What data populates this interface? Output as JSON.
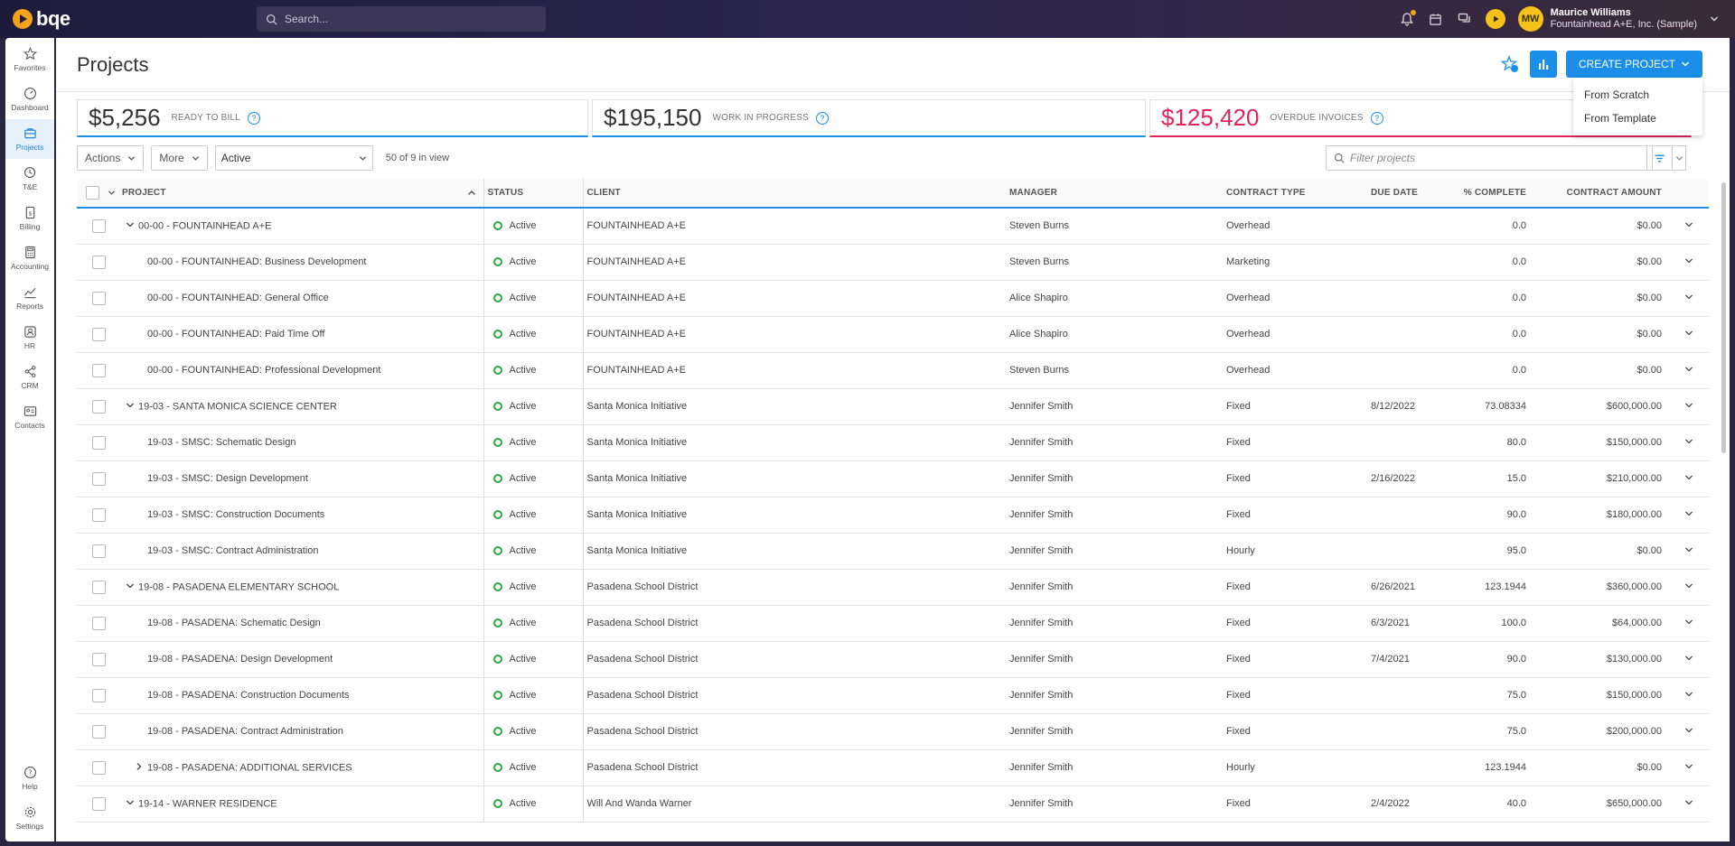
{
  "app": {
    "logo_text": "bqe",
    "search_placeholder": "Search..."
  },
  "user": {
    "initials": "MW",
    "name": "Maurice Williams",
    "org": "Fountainhead A+E, Inc. (Sample)"
  },
  "sidebar": {
    "items": [
      {
        "label": "Favorites",
        "icon": "star-icon"
      },
      {
        "label": "Dashboard",
        "icon": "dashboard-icon"
      },
      {
        "label": "Projects",
        "icon": "projects-icon",
        "active": true
      },
      {
        "label": "T&E",
        "icon": "clock-icon"
      },
      {
        "label": "Billing",
        "icon": "billing-icon"
      },
      {
        "label": "Accounting",
        "icon": "calculator-icon"
      },
      {
        "label": "Reports",
        "icon": "reports-icon"
      },
      {
        "label": "HR",
        "icon": "hr-icon"
      },
      {
        "label": "CRM",
        "icon": "crm-icon"
      },
      {
        "label": "Contacts",
        "icon": "contacts-icon"
      }
    ],
    "bottom": [
      {
        "label": "Help",
        "icon": "help-icon"
      },
      {
        "label": "Settings",
        "icon": "gear-icon"
      }
    ]
  },
  "page": {
    "title": "Projects",
    "create_label": "CREATE PROJECT",
    "create_menu": [
      "From Scratch",
      "From Template"
    ]
  },
  "kpis": [
    {
      "value": "$5,256",
      "label": "READY TO BILL",
      "color": "#333333",
      "accent": "#1a8ee8"
    },
    {
      "value": "$195,150",
      "label": "WORK IN PROGRESS",
      "color": "#333333",
      "accent": "#1a8ee8"
    },
    {
      "value": "$125,420",
      "label": "OVERDUE INVOICES",
      "color": "#e0245e",
      "accent": "#e0245e"
    }
  ],
  "toolbar": {
    "actions_label": "Actions",
    "more_label": "More",
    "status_filter": "Active",
    "in_view": "50 of 9 in view",
    "filter_placeholder": "Filter projects"
  },
  "table": {
    "headers": [
      "PROJECT",
      "STATUS",
      "CLIENT",
      "MANAGER",
      "CONTRACT TYPE",
      "DUE DATE",
      "% COMPLETE",
      "CONTRACT AMOUNT"
    ],
    "rows": [
      {
        "level": 0,
        "expander": "down",
        "project": "00-00 - FOUNTAINHEAD A+E",
        "status": "Active",
        "client": "FOUNTAINHEAD A+E",
        "manager": "Steven Burns",
        "type": "Overhead",
        "due": "",
        "pct": "0.0",
        "amount": "$0.00"
      },
      {
        "level": 1,
        "expander": "",
        "project": "00-00 - FOUNTAINHEAD: Business Development",
        "status": "Active",
        "client": "FOUNTAINHEAD A+E",
        "manager": "Steven Burns",
        "type": "Marketing",
        "due": "",
        "pct": "0.0",
        "amount": "$0.00"
      },
      {
        "level": 1,
        "expander": "",
        "project": "00-00 - FOUNTAINHEAD: General Office",
        "status": "Active",
        "client": "FOUNTAINHEAD A+E",
        "manager": "Alice Shapiro",
        "type": "Overhead",
        "due": "",
        "pct": "0.0",
        "amount": "$0.00"
      },
      {
        "level": 1,
        "expander": "",
        "project": "00-00 - FOUNTAINHEAD: Paid Time Off",
        "status": "Active",
        "client": "FOUNTAINHEAD A+E",
        "manager": "Alice Shapiro",
        "type": "Overhead",
        "due": "",
        "pct": "0.0",
        "amount": "$0.00"
      },
      {
        "level": 1,
        "expander": "",
        "project": "00-00 - FOUNTAINHEAD: Professional Development",
        "status": "Active",
        "client": "FOUNTAINHEAD A+E",
        "manager": "Steven Burns",
        "type": "Overhead",
        "due": "",
        "pct": "0.0",
        "amount": "$0.00"
      },
      {
        "level": 0,
        "expander": "down",
        "project": "19-03 - SANTA MONICA SCIENCE CENTER",
        "status": "Active",
        "client": "Santa Monica Initiative",
        "manager": "Jennifer Smith",
        "type": "Fixed",
        "due": "8/12/2022",
        "pct": "73.08334",
        "amount": "$600,000.00"
      },
      {
        "level": 1,
        "expander": "",
        "project": "19-03 - SMSC: Schematic Design",
        "status": "Active",
        "client": "Santa Monica Initiative",
        "manager": "Jennifer Smith",
        "type": "Fixed",
        "due": "",
        "pct": "80.0",
        "amount": "$150,000.00"
      },
      {
        "level": 1,
        "expander": "",
        "project": "19-03 - SMSC: Design Development",
        "status": "Active",
        "client": "Santa Monica Initiative",
        "manager": "Jennifer Smith",
        "type": "Fixed",
        "due": "2/16/2022",
        "pct": "15.0",
        "amount": "$210,000.00"
      },
      {
        "level": 1,
        "expander": "",
        "project": "19-03 - SMSC: Construction Documents",
        "status": "Active",
        "client": "Santa Monica Initiative",
        "manager": "Jennifer Smith",
        "type": "Fixed",
        "due": "",
        "pct": "90.0",
        "amount": "$180,000.00"
      },
      {
        "level": 1,
        "expander": "",
        "project": "19-03 - SMSC: Contract Administration",
        "status": "Active",
        "client": "Santa Monica Initiative",
        "manager": "Jennifer Smith",
        "type": "Hourly",
        "due": "",
        "pct": "95.0",
        "amount": "$0.00"
      },
      {
        "level": 0,
        "expander": "down",
        "project": "19-08 - PASADENA ELEMENTARY SCHOOL",
        "status": "Active",
        "client": "Pasadena School District",
        "manager": "Jennifer Smith",
        "type": "Fixed",
        "due": "6/26/2021",
        "pct": "123.1944",
        "amount": "$360,000.00"
      },
      {
        "level": 1,
        "expander": "",
        "project": "19-08 - PASADENA: Schematic Design",
        "status": "Active",
        "client": "Pasadena School District",
        "manager": "Jennifer Smith",
        "type": "Fixed",
        "due": "6/3/2021",
        "pct": "100.0",
        "amount": "$64,000.00"
      },
      {
        "level": 1,
        "expander": "",
        "project": "19-08 - PASADENA: Design Development",
        "status": "Active",
        "client": "Pasadena School District",
        "manager": "Jennifer Smith",
        "type": "Fixed",
        "due": "7/4/2021",
        "pct": "90.0",
        "amount": "$130,000.00"
      },
      {
        "level": 1,
        "expander": "",
        "project": "19-08 - PASADENA: Construction Documents",
        "status": "Active",
        "client": "Pasadena School District",
        "manager": "Jennifer Smith",
        "type": "Fixed",
        "due": "",
        "pct": "75.0",
        "amount": "$150,000.00"
      },
      {
        "level": 1,
        "expander": "",
        "project": "19-08 - PASADENA: Contract Administration",
        "status": "Active",
        "client": "Pasadena School District",
        "manager": "Jennifer Smith",
        "type": "Fixed",
        "due": "",
        "pct": "75.0",
        "amount": "$200,000.00"
      },
      {
        "level": 1,
        "expander": "right",
        "project": "19-08 - PASADENA: ADDITIONAL SERVICES",
        "status": "Active",
        "client": "Pasadena School District",
        "manager": "Jennifer Smith",
        "type": "Hourly",
        "due": "",
        "pct": "123.1944",
        "amount": "$0.00"
      },
      {
        "level": 0,
        "expander": "down",
        "project": "19-14 - WARNER RESIDENCE",
        "status": "Active",
        "client": "Will And Wanda Warner",
        "manager": "Jennifer Smith",
        "type": "Fixed",
        "due": "2/4/2022",
        "pct": "40.0",
        "amount": "$650,000.00"
      }
    ]
  }
}
